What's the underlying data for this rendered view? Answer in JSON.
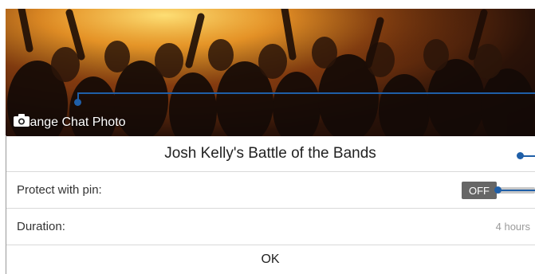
{
  "header": {
    "change_photo_label": "Change Chat Photo",
    "camera_icon": "camera-icon"
  },
  "chat": {
    "title": "Josh Kelly's Battle of the Bands"
  },
  "settings": {
    "pin_label": "Protect with pin:",
    "pin_toggle_text": "OFF",
    "duration_label": "Duration:",
    "duration_value": "4 hours"
  },
  "actions": {
    "ok_label": "OK"
  },
  "colors": {
    "annotation": "#1f5fa8",
    "toggle_off": "#666666",
    "divider": "#d9d9d9"
  }
}
